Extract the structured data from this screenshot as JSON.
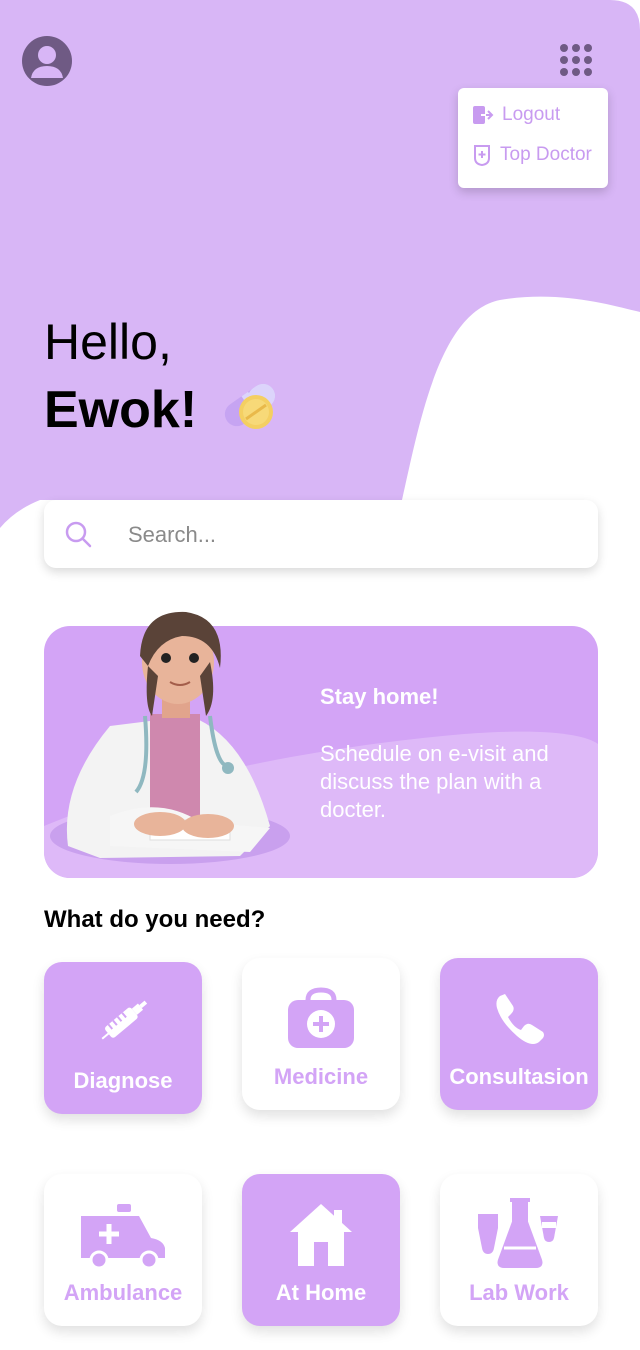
{
  "colors": {
    "lavender": "#d8b6f6",
    "accent": "#d3a4f6",
    "dark": "#6f5a84"
  },
  "header": {
    "avatar_icon": "user-avatar-icon",
    "menu_icon": "grid-menu-icon"
  },
  "menu": {
    "logout_label": "Logout",
    "top_doctor_label": "Top Doctor"
  },
  "greeting": {
    "hello": "Hello,",
    "name": "Ewok!"
  },
  "search": {
    "placeholder": "Search...",
    "value": ""
  },
  "banner": {
    "title": "Stay home!",
    "body": "Schedule on e-visit and discuss the plan with a docter."
  },
  "services": {
    "heading": "What do you need?",
    "items": [
      {
        "label": "Diagnose",
        "icon": "syringe-icon"
      },
      {
        "label": "Medicine",
        "icon": "medicine-bag-icon"
      },
      {
        "label": "Consultasion",
        "icon": "phone-icon"
      },
      {
        "label": "Ambulance",
        "icon": "ambulance-icon"
      },
      {
        "label": "At Home",
        "icon": "house-icon"
      },
      {
        "label": "Lab Work",
        "icon": "lab-flask-icon"
      }
    ]
  }
}
